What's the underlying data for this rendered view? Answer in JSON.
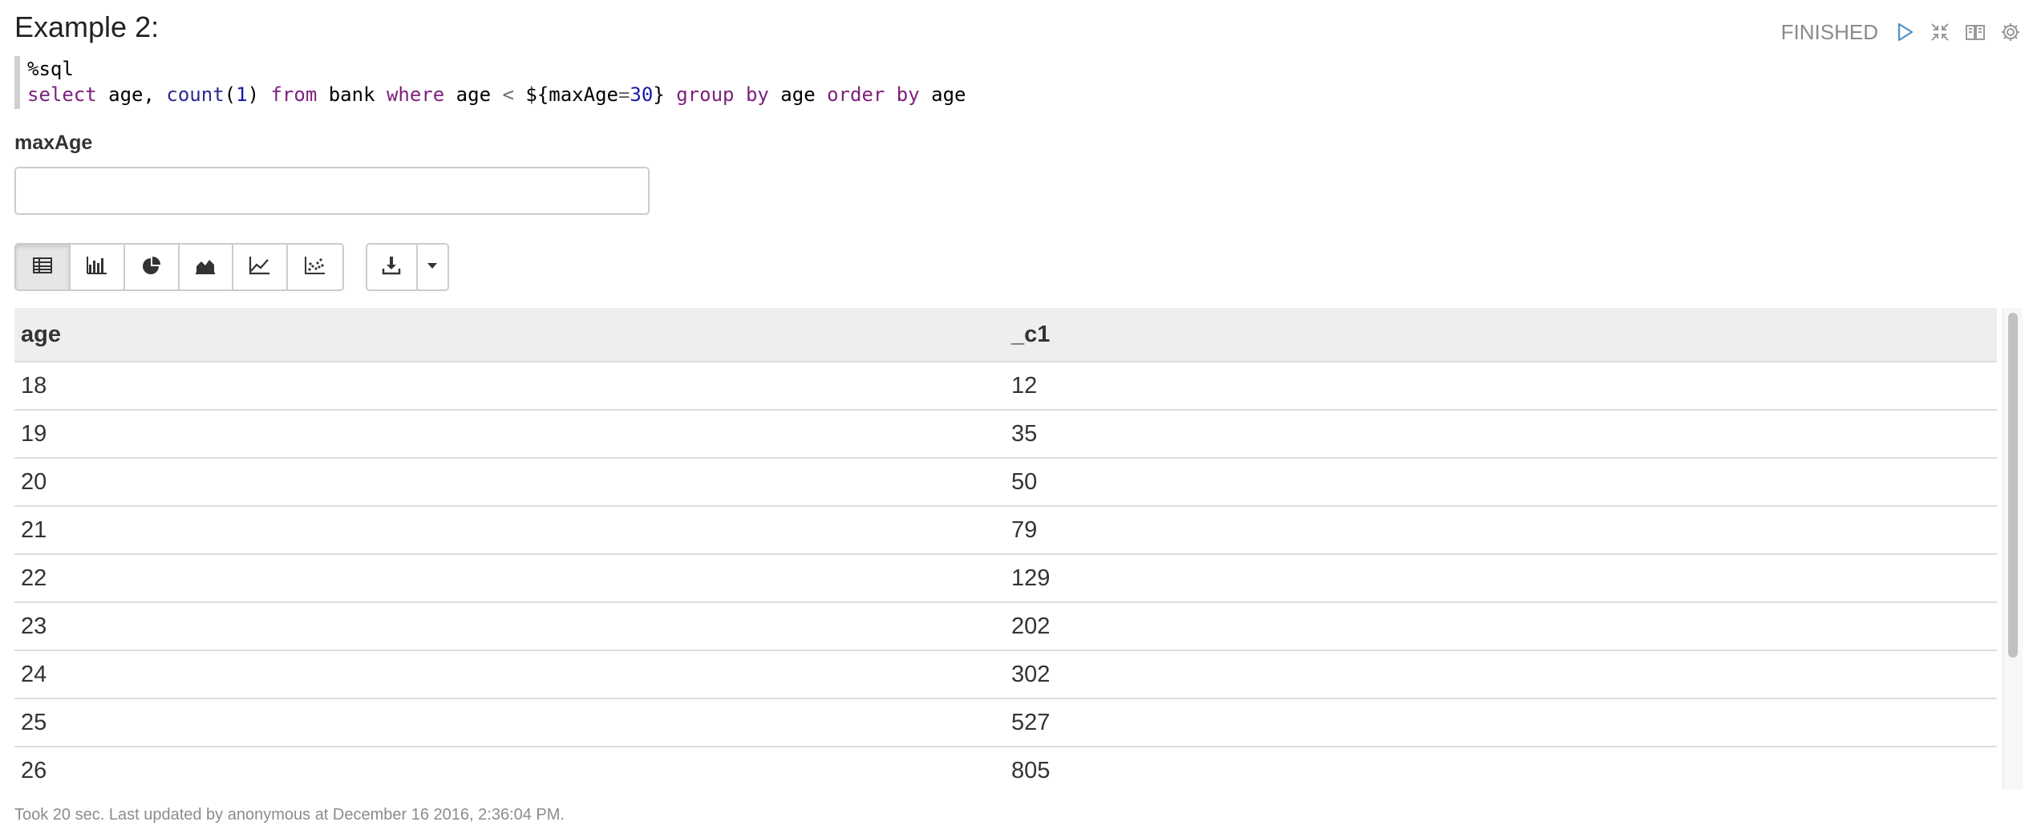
{
  "paragraph": {
    "title": "Example 2:",
    "status": "FINISHED",
    "icons": [
      "play-icon",
      "collapse-icon",
      "book-icon",
      "gear-icon"
    ]
  },
  "editor": {
    "line1": "%sql",
    "line2_tokens": [
      {
        "text": "select",
        "cls": "kw"
      },
      {
        "text": " age, ",
        "cls": ""
      },
      {
        "text": "count",
        "cls": "fn"
      },
      {
        "text": "(",
        "cls": ""
      },
      {
        "text": "1",
        "cls": "num"
      },
      {
        "text": ") ",
        "cls": ""
      },
      {
        "text": "from",
        "cls": "kw"
      },
      {
        "text": " bank ",
        "cls": ""
      },
      {
        "text": "where",
        "cls": "kw"
      },
      {
        "text": " age ",
        "cls": ""
      },
      {
        "text": "<",
        "cls": "op"
      },
      {
        "text": " ${maxAge",
        "cls": ""
      },
      {
        "text": "=",
        "cls": "op"
      },
      {
        "text": "30",
        "cls": "num"
      },
      {
        "text": "} ",
        "cls": ""
      },
      {
        "text": "group",
        "cls": "kw"
      },
      {
        "text": " ",
        "cls": ""
      },
      {
        "text": "by",
        "cls": "kw"
      },
      {
        "text": " age ",
        "cls": ""
      },
      {
        "text": "order",
        "cls": "kw"
      },
      {
        "text": " ",
        "cls": ""
      },
      {
        "text": "by",
        "cls": "kw"
      },
      {
        "text": " age",
        "cls": ""
      }
    ]
  },
  "form": {
    "label": "maxAge",
    "value": "",
    "placeholder": ""
  },
  "toolbar": {
    "viz_buttons": [
      "table-icon",
      "bar-chart-icon",
      "pie-chart-icon",
      "area-chart-icon",
      "line-chart-icon",
      "scatter-chart-icon"
    ],
    "active": "table-icon",
    "download_icon": "download-icon",
    "dropdown_icon": "caret-down-icon"
  },
  "table": {
    "columns": [
      "age",
      "_c1"
    ],
    "rows": [
      [
        "18",
        "12"
      ],
      [
        "19",
        "35"
      ],
      [
        "20",
        "50"
      ],
      [
        "21",
        "79"
      ],
      [
        "22",
        "129"
      ],
      [
        "23",
        "202"
      ],
      [
        "24",
        "302"
      ],
      [
        "25",
        "527"
      ],
      [
        "26",
        "805"
      ]
    ]
  },
  "footer": {
    "text": "Took 20 sec. Last updated by anonymous at December 16 2016, 2:36:04 PM."
  },
  "colors": {
    "keyword": "#7c1f7c",
    "function": "#2b2b8f",
    "number": "#1a1aa6",
    "status": "#8a8a8a",
    "header_bg": "#eeeeee"
  }
}
